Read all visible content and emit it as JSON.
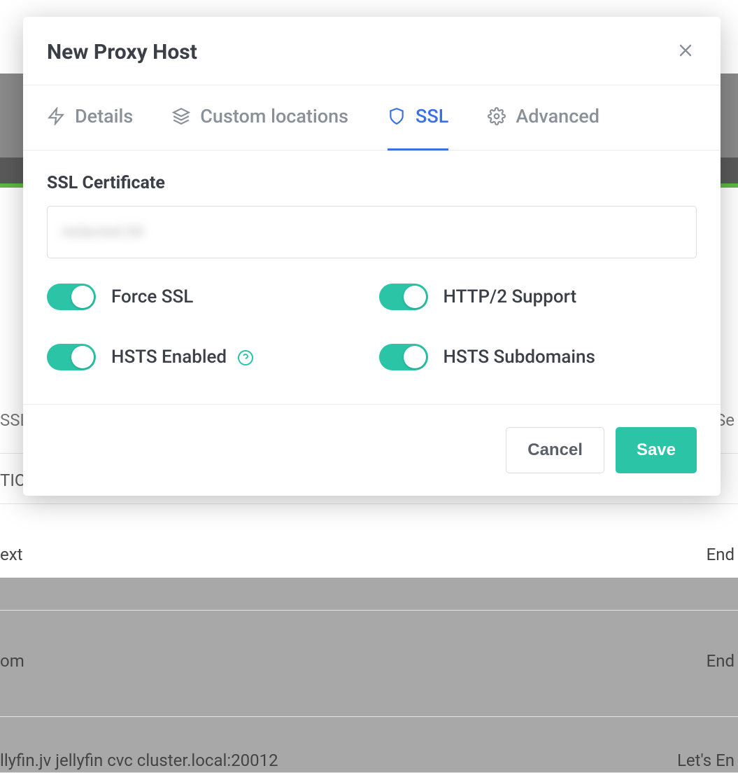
{
  "backdrop": {
    "ssl": "SSL",
    "se": "Se",
    "tio": "TIO",
    "ext": "ext",
    "om": "om",
    "end1": "End",
    "end2": "End",
    "last": "llyfin.jv jellyfin cvc cluster.local:20012",
    "lastRight": "Let's En"
  },
  "modal": {
    "title": "New Proxy Host"
  },
  "tabs": [
    {
      "label": "Details"
    },
    {
      "label": "Custom locations"
    },
    {
      "label": "SSL"
    },
    {
      "label": "Advanced"
    }
  ],
  "ssl": {
    "certificateLabel": "SSL Certificate",
    "certificateValue": "redacted.tld",
    "toggles": {
      "forceSsl": "Force SSL",
      "http2": "HTTP/2 Support",
      "hstsEnabled": "HSTS Enabled",
      "hstsSubdomains": "HSTS Subdomains"
    }
  },
  "footer": {
    "cancel": "Cancel",
    "save": "Save"
  }
}
